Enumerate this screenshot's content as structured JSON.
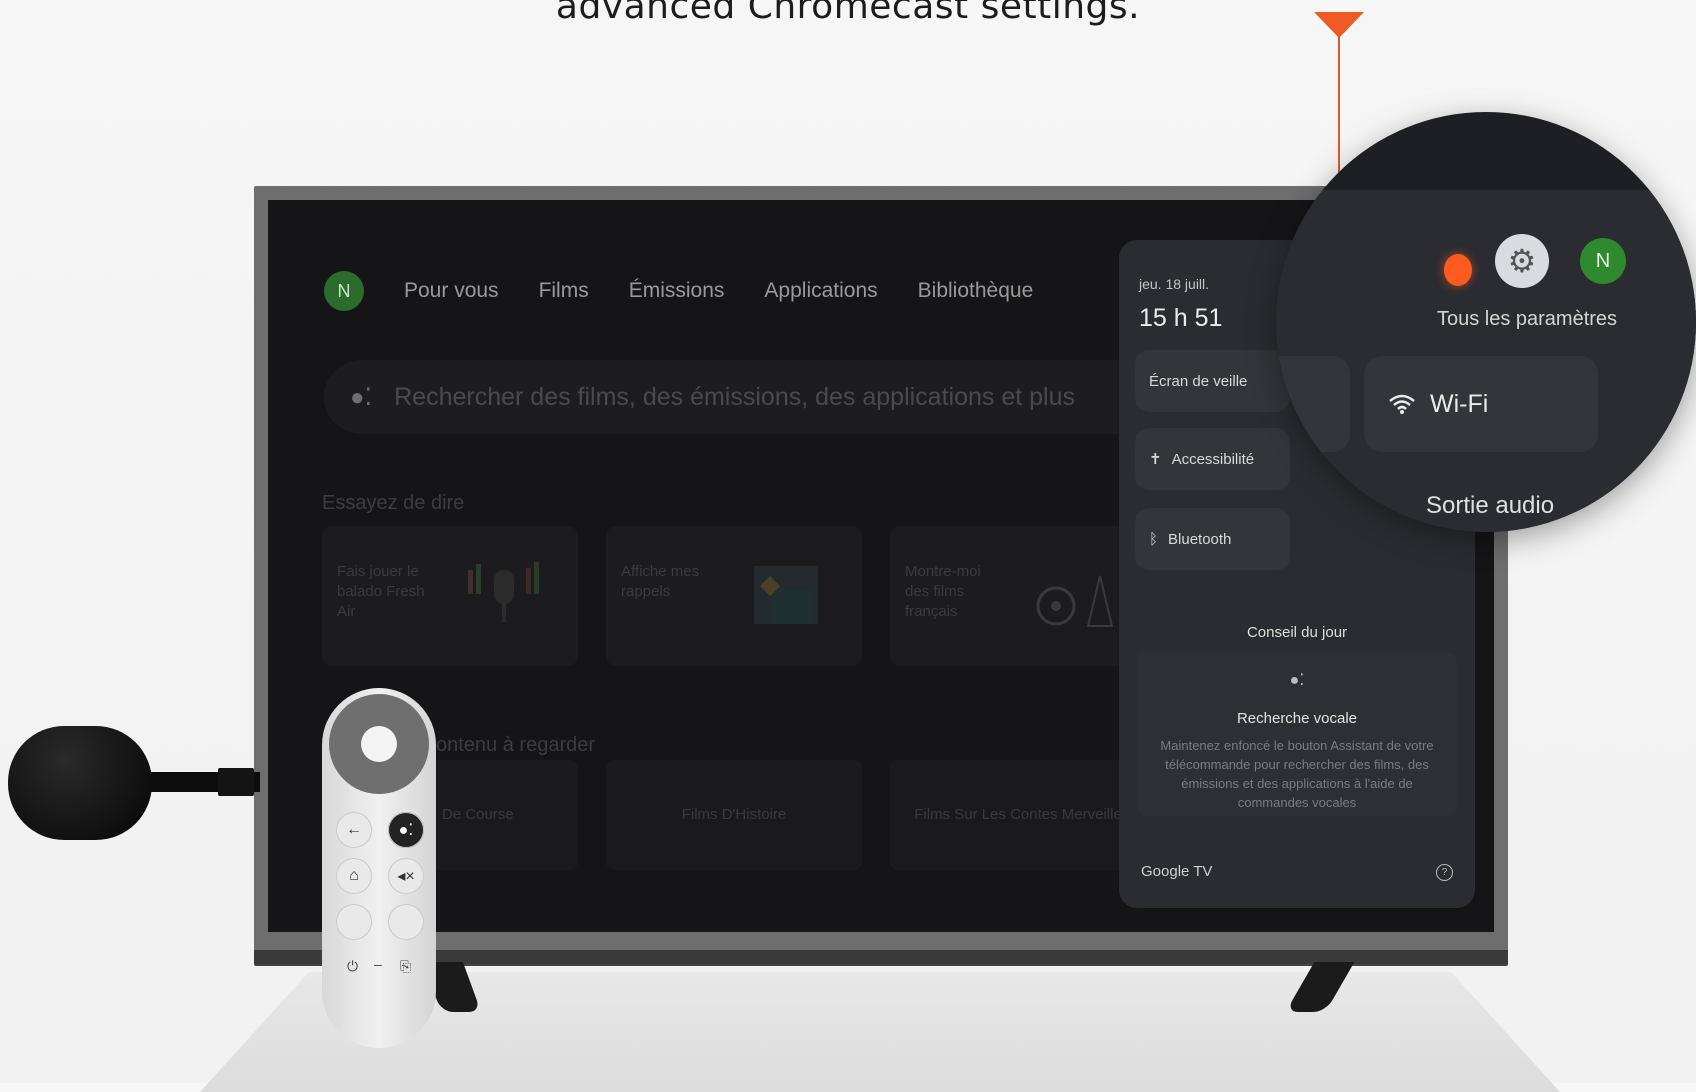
{
  "caption": "advanced Chromecast settings.",
  "screen": {
    "nav": {
      "avatar_initial": "N",
      "items": [
        "Pour vous",
        "Films",
        "Émissions",
        "Applications",
        "Bibliothèque"
      ]
    },
    "search_placeholder": "Rechercher des films, des émissions, des applications et plus",
    "try_saying_label": "Essayez de dire",
    "suggestion_cards": [
      "Fais jouer le balado Fresh Air",
      "Affiche mes rappels",
      "Montre-moi des films français"
    ],
    "content_label": "ontenu à regarder",
    "tiles": [
      "De Course",
      "Films D'Histoire",
      "Films Sur Les Contes Merveille"
    ]
  },
  "panel": {
    "date": "jeu. 18 juill.",
    "time": "15 h 51",
    "buttons": {
      "screensaver": "Écran de veille",
      "accessibility": "Accessibilité",
      "bluetooth": "Bluetooth"
    },
    "tip_heading": "Conseil du jour",
    "tip_title": "Recherche vocale",
    "tip_body": "Maintenez enfoncé le bouton Assistant de votre télécommande pour rechercher des films, des émissions et des applications à l'aide de commandes vocales",
    "footer": "Google TV",
    "help_icon": "?"
  },
  "magnifier": {
    "settings_label": "Tous les paramètres",
    "avatar_initial": "N",
    "wifi_label": "Wi-Fi",
    "audio_label": "Sortie audio"
  },
  "colors": {
    "accent_orange": "#ef5b25",
    "avatar_green": "#2f8a2f"
  }
}
